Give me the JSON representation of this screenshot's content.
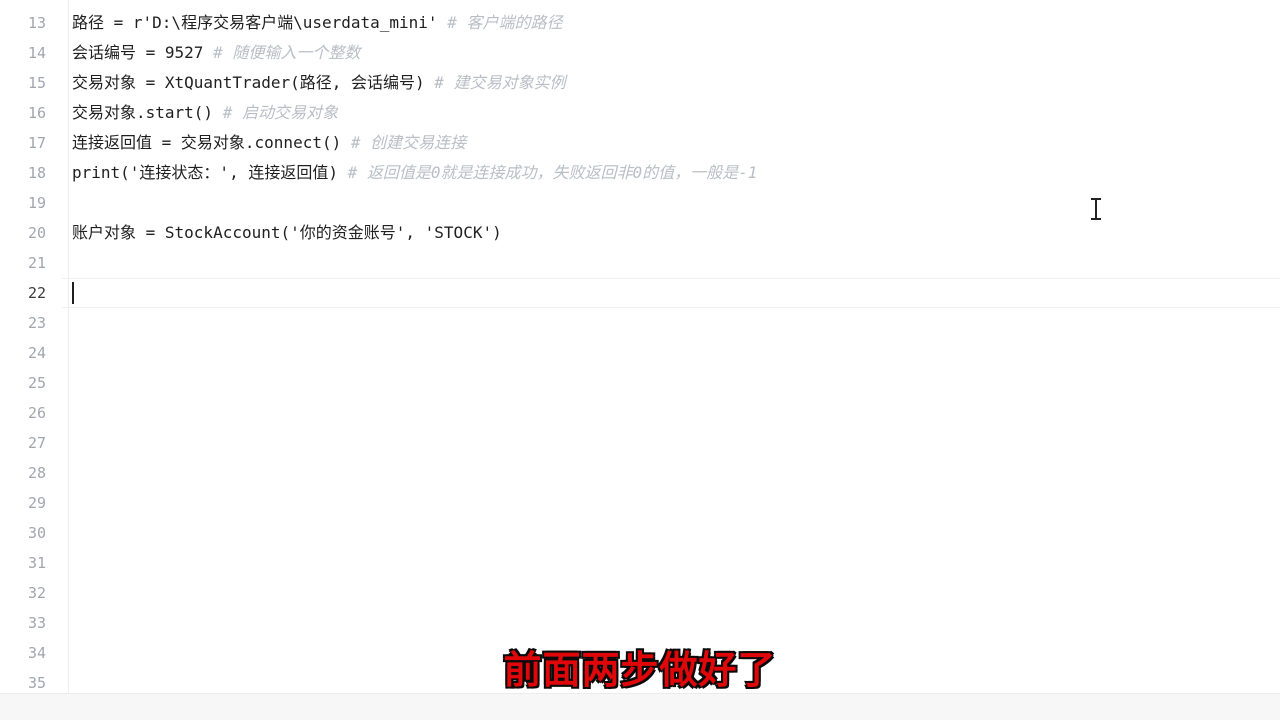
{
  "editor": {
    "lines": [
      {
        "number": "13",
        "code": "路径 = r'D:\\程序交易客户端\\userdata_mini' ",
        "comment": "# 客户端的路径"
      },
      {
        "number": "14",
        "code": "会话编号 = 9527 ",
        "comment": "# 随便输入一个整数"
      },
      {
        "number": "15",
        "code": "交易对象 = XtQuantTrader(路径, 会话编号) ",
        "comment": "# 建交易对象实例"
      },
      {
        "number": "16",
        "code": "交易对象.start() ",
        "comment": "# 启动交易对象"
      },
      {
        "number": "17",
        "code": "连接返回值 = 交易对象.connect() ",
        "comment": "# 创建交易连接"
      },
      {
        "number": "18",
        "code": "print('连接状态：', 连接返回值) ",
        "comment": "# 返回值是0就是连接成功，失败返回非0的值，一般是-1"
      },
      {
        "number": "19",
        "code": "",
        "comment": ""
      },
      {
        "number": "20",
        "code": "账户对象 = StockAccount('你的资金账号', 'STOCK')",
        "comment": ""
      },
      {
        "number": "21",
        "code": "",
        "comment": ""
      },
      {
        "number": "22",
        "code": "",
        "comment": ""
      },
      {
        "number": "23",
        "code": "",
        "comment": ""
      },
      {
        "number": "24",
        "code": "",
        "comment": ""
      },
      {
        "number": "25",
        "code": "",
        "comment": ""
      },
      {
        "number": "26",
        "code": "",
        "comment": ""
      },
      {
        "number": "27",
        "code": "",
        "comment": ""
      },
      {
        "number": "28",
        "code": "",
        "comment": ""
      },
      {
        "number": "29",
        "code": "",
        "comment": ""
      },
      {
        "number": "30",
        "code": "",
        "comment": ""
      },
      {
        "number": "31",
        "code": "",
        "comment": ""
      },
      {
        "number": "32",
        "code": "",
        "comment": ""
      },
      {
        "number": "33",
        "code": "",
        "comment": ""
      },
      {
        "number": "34",
        "code": "",
        "comment": ""
      },
      {
        "number": "35",
        "code": "",
        "comment": ""
      }
    ],
    "current_line": "22"
  },
  "subtitle": {
    "text": "前面两步做好了"
  },
  "colors": {
    "comment": "#b9bec6",
    "code": "#1f1f1f",
    "line_number": "#a1a6ae",
    "subtitle": "#e0070b"
  }
}
